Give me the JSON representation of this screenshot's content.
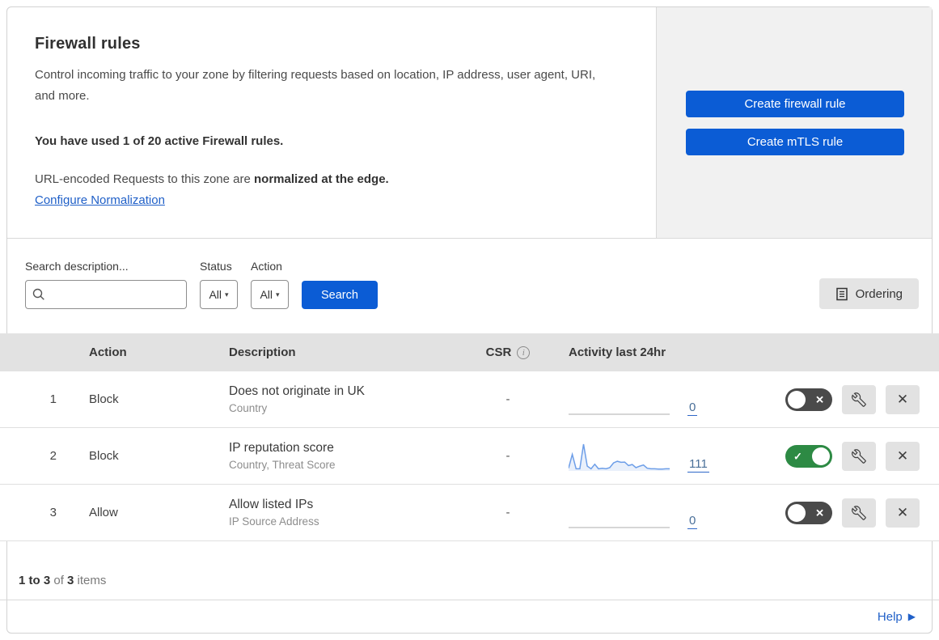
{
  "header": {
    "title": "Firewall rules",
    "description": "Control incoming traffic to your zone by filtering requests based on location, IP address, user agent, URI, and more.",
    "usage": "You have used 1 of 20 active Firewall rules.",
    "normalization_prefix": "URL-encoded Requests to this zone are ",
    "normalization_bold": "normalized at the edge.",
    "normalization_link": "Configure Normalization",
    "create_firewall_button": "Create firewall rule",
    "create_mtls_button": "Create mTLS rule"
  },
  "filters": {
    "search_label": "Search description...",
    "search_value": "",
    "status_label": "Status",
    "status_value": "All",
    "action_label": "Action",
    "action_value": "All",
    "search_button": "Search",
    "ordering_button": "Ordering"
  },
  "table": {
    "columns": {
      "action": "Action",
      "description": "Description",
      "csr": "CSR",
      "activity": "Activity last 24hr"
    },
    "rows": [
      {
        "priority": "1",
        "action": "Block",
        "description": "Does not originate in UK",
        "fields": "Country",
        "csr": "-",
        "activity_count": "0",
        "enabled": false,
        "sparkline": [
          0,
          0
        ]
      },
      {
        "priority": "2",
        "action": "Block",
        "description": "IP reputation score",
        "fields": "Country, Threat Score",
        "csr": "-",
        "activity_count": "111",
        "enabled": true,
        "sparkline": [
          10,
          62,
          8,
          8,
          100,
          18,
          8,
          25,
          8,
          10,
          8,
          12,
          30,
          36,
          32,
          33,
          20,
          24,
          12,
          18,
          22,
          10,
          8,
          8,
          7,
          7,
          8,
          8
        ]
      },
      {
        "priority": "3",
        "action": "Allow",
        "description": "Allow listed IPs",
        "fields": "IP Source Address",
        "csr": "-",
        "activity_count": "0",
        "enabled": false,
        "sparkline": [
          0,
          0
        ]
      }
    ]
  },
  "footer": {
    "range": "1 to 3",
    "of_text": " of ",
    "total": "3",
    "items_text": " items",
    "help_label": "Help"
  },
  "glyphs": {
    "check": "✓",
    "x": "✕",
    "caret": "▾",
    "arrow": "▶",
    "info": "i"
  },
  "icons": {
    "search": "magnifier-icon",
    "ordering": "document-list-icon",
    "csr_info": "info-circle-icon",
    "edit": "wrench-icon",
    "delete": "x-icon",
    "help": "right-triangle-icon"
  },
  "colors": {
    "primary_button": "#0b5cd5",
    "link": "#2060c8",
    "toggle_on": "#2d8a44",
    "toggle_off": "#4a4a4a",
    "spark_line": "#6d9ee8",
    "spark_fill": "#e9f0fb",
    "spark_flat": "#c9c9c9",
    "header_band": "#e2e2e2",
    "side_panel": "#f1f1f1",
    "icon_button_bg": "#e2e2e2"
  }
}
